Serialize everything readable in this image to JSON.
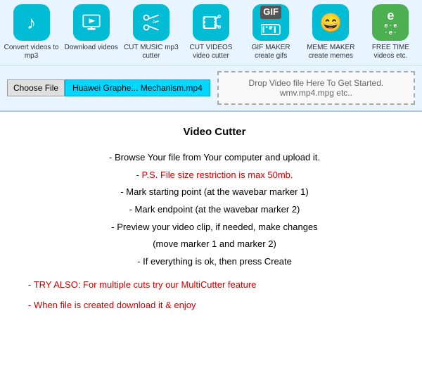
{
  "nav": {
    "items": [
      {
        "id": "convert-mp3",
        "label": "Convert videos to mp3",
        "icon_type": "music-note",
        "icon_color": "#00bcd4",
        "icon_text": "♪"
      },
      {
        "id": "download-videos",
        "label": "Download videos",
        "icon_type": "film",
        "icon_color": "#00bcd4",
        "icon_text": "🎬"
      },
      {
        "id": "cut-music",
        "label": "CUT MUSIC mp3 cutter",
        "icon_type": "scissors-music",
        "icon_color": "#00bcd4",
        "icon_text": "✂♪"
      },
      {
        "id": "cut-videos",
        "label": "CUT VIDEOS video cutter",
        "icon_type": "scissors-video",
        "icon_color": "#00bcd4",
        "icon_text": "✂🎬"
      },
      {
        "id": "gif-maker",
        "label": "GIF MAKER create gifs",
        "icon_type": "gif",
        "icon_color": "#00bcd4",
        "icon_text": "GIF"
      },
      {
        "id": "meme-maker",
        "label": "MEME MAKER create memes",
        "icon_type": "meme",
        "icon_color": "#00bcd4",
        "icon_text": "😊"
      },
      {
        "id": "free-time",
        "label": "FREE TIME videos etc.",
        "icon_type": "free",
        "icon_color": "#4caf50",
        "icon_text": "e"
      }
    ]
  },
  "upload": {
    "choose_file_label": "Choose File",
    "file_name": "Huawei Graphe... Mechanism.mp4",
    "drop_zone_text": "Drop Video file Here To Get Started.\nwmv.mp4.mpg etc.."
  },
  "content": {
    "title": "Video Cutter",
    "instructions": [
      {
        "text": "- Browse Your file from Your computer and upload it.",
        "red": false
      },
      {
        "text": "- P.S. File size restriction is max 50mb.",
        "red": true
      },
      {
        "text": "- Mark starting point (at the wavebar marker 1)",
        "red": false
      },
      {
        "text": "- Mark endpoint (at the wavebar marker 2)",
        "red": false
      },
      {
        "text": "- Preview your video clip, if needed, make changes",
        "red": false
      },
      {
        "text": "(move marker 1 and marker 2)",
        "red": false
      },
      {
        "text": "- If everything is ok, then press Create",
        "red": false
      }
    ],
    "try_also_line1": "- TRY ALSO: For multiple cuts try our MultiCutter feature",
    "try_also_line2": "- When file is created download it & enjoy"
  }
}
